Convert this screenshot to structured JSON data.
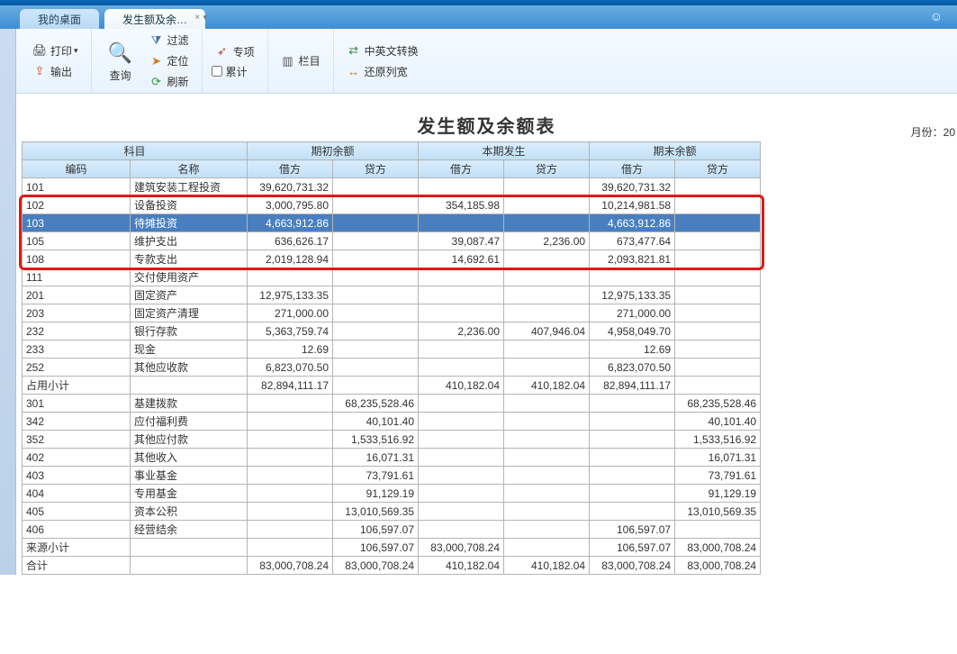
{
  "tabs": {
    "desktop": "我的桌面",
    "report": "发生额及余…"
  },
  "toolbar": {
    "print": "打印",
    "export": "输出",
    "query": "查询",
    "filter": "过滤",
    "locate": "定位",
    "refresh": "刷新",
    "special": "专项",
    "cumulative": "累计",
    "columns": "栏目",
    "cn_en": "中英文转换",
    "restore_width": "还原列宽"
  },
  "report": {
    "title": "发生额及余额表",
    "month_label": "月份：20"
  },
  "headers": {
    "subject": "科目",
    "code": "编码",
    "name": "名称",
    "opening": "期初余额",
    "current": "本期发生",
    "closing": "期末余额",
    "debit": "借方",
    "credit": "贷方"
  },
  "rows": [
    {
      "code": "101",
      "name": "建筑安装工程投资",
      "ob": "39,620,731.32",
      "oc": "",
      "cb": "",
      "cc": "",
      "eb": "39,620,731.32",
      "ec": ""
    },
    {
      "code": "102",
      "name": "设备投资",
      "ob": "3,000,795.80",
      "oc": "",
      "cb": "354,185.98",
      "cc": "",
      "eb": "10,214,981.58",
      "ec": ""
    },
    {
      "code": "103",
      "name": "待摊投资",
      "ob": "4,663,912.86",
      "oc": "",
      "cb": "",
      "cc": "",
      "eb": "4,663,912.86",
      "ec": "",
      "selected": true
    },
    {
      "code": "105",
      "name": "维护支出",
      "ob": "636,626.17",
      "oc": "",
      "cb": "39,087.47",
      "cc": "2,236.00",
      "eb": "673,477.64",
      "ec": ""
    },
    {
      "code": "108",
      "name": "专款支出",
      "ob": "2,019,128.94",
      "oc": "",
      "cb": "14,692.61",
      "cc": "",
      "eb": "2,093,821.81",
      "ec": ""
    },
    {
      "code": "111",
      "name": "交付使用资产",
      "ob": "",
      "oc": "",
      "cb": "",
      "cc": "",
      "eb": "",
      "ec": ""
    },
    {
      "code": "201",
      "name": "固定资产",
      "ob": "12,975,133.35",
      "oc": "",
      "cb": "",
      "cc": "",
      "eb": "12,975,133.35",
      "ec": ""
    },
    {
      "code": "203",
      "name": "固定资产清理",
      "ob": "271,000.00",
      "oc": "",
      "cb": "",
      "cc": "",
      "eb": "271,000.00",
      "ec": ""
    },
    {
      "code": "232",
      "name": "银行存款",
      "ob": "5,363,759.74",
      "oc": "",
      "cb": "2,236.00",
      "cc": "407,946.04",
      "eb": "4,958,049.70",
      "ec": ""
    },
    {
      "code": "233",
      "name": "现金",
      "ob": "12.69",
      "oc": "",
      "cb": "",
      "cc": "",
      "eb": "12.69",
      "ec": ""
    },
    {
      "code": "252",
      "name": "其他应收款",
      "ob": "6,823,070.50",
      "oc": "",
      "cb": "",
      "cc": "",
      "eb": "6,823,070.50",
      "ec": ""
    },
    {
      "code": "占用小计",
      "name": "",
      "ob": "82,894,111.17",
      "oc": "",
      "cb": "410,182.04",
      "cc": "410,182.04",
      "eb": "82,894,111.17",
      "ec": ""
    },
    {
      "code": "301",
      "name": "基建拨款",
      "ob": "",
      "oc": "68,235,528.46",
      "cb": "",
      "cc": "",
      "eb": "",
      "ec": "68,235,528.46"
    },
    {
      "code": "342",
      "name": "应付福利费",
      "ob": "",
      "oc": "40,101.40",
      "cb": "",
      "cc": "",
      "eb": "",
      "ec": "40,101.40"
    },
    {
      "code": "352",
      "name": "其他应付款",
      "ob": "",
      "oc": "1,533,516.92",
      "cb": "",
      "cc": "",
      "eb": "",
      "ec": "1,533,516.92"
    },
    {
      "code": "402",
      "name": "其他收入",
      "ob": "",
      "oc": "16,071.31",
      "cb": "",
      "cc": "",
      "eb": "",
      "ec": "16,071.31"
    },
    {
      "code": "403",
      "name": "事业基金",
      "ob": "",
      "oc": "73,791.61",
      "cb": "",
      "cc": "",
      "eb": "",
      "ec": "73,791.61"
    },
    {
      "code": "404",
      "name": "专用基金",
      "ob": "",
      "oc": "91,129.19",
      "cb": "",
      "cc": "",
      "eb": "",
      "ec": "91,129.19"
    },
    {
      "code": "405",
      "name": "资本公积",
      "ob": "",
      "oc": "13,010,569.35",
      "cb": "",
      "cc": "",
      "eb": "",
      "ec": "13,010,569.35"
    },
    {
      "code": "406",
      "name": "经营结余",
      "ob": "",
      "oc": "106,597.07",
      "cb": "",
      "cc": "",
      "eb": "106,597.07",
      "ec": ""
    },
    {
      "code": "来源小计",
      "name": "",
      "ob": "",
      "oc": "106,597.07",
      "cb": "83,000,708.24",
      "cc": "",
      "eb": "106,597.07",
      "ec": "83,000,708.24"
    },
    {
      "code": "合计",
      "name": "",
      "ob": "83,000,708.24",
      "oc": "83,000,708.24",
      "cb": "410,182.04",
      "cc": "410,182.04",
      "eb": "83,000,708.24",
      "ec": "83,000,708.24"
    }
  ]
}
